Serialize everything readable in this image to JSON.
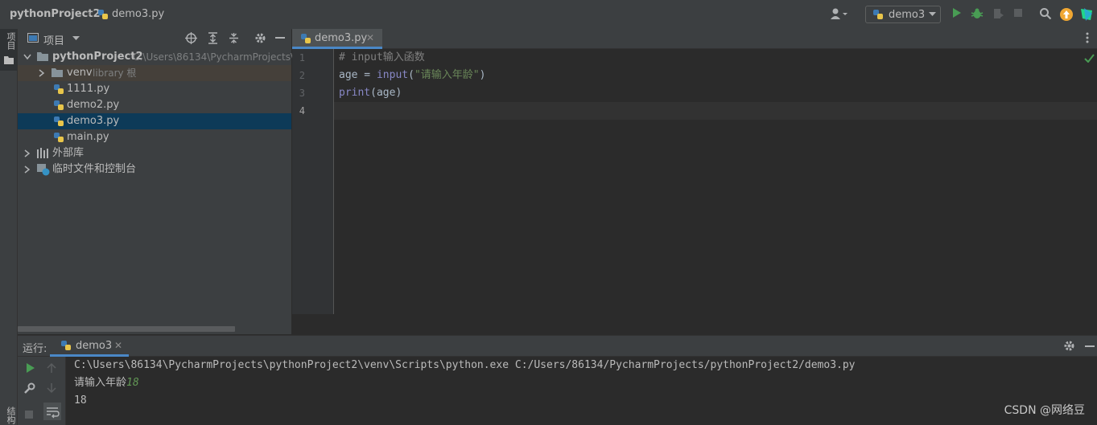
{
  "titlebar": {
    "project": "pythonProject2",
    "file": "demo3.py",
    "run_config": "demo3"
  },
  "left_strip": {
    "project_tab": "项目",
    "structure_tab": "结构"
  },
  "project_panel": {
    "title": "项目",
    "tree": [
      {
        "label": "pythonProject2",
        "hint": "C:\\Users\\86134\\PycharmProjects\\p",
        "type": "folder",
        "expanded": true
      },
      {
        "label": "venv",
        "hint": "library 根",
        "type": "folder",
        "expanded": false
      },
      {
        "label": "1111.py",
        "type": "python-file"
      },
      {
        "label": "demo2.py",
        "type": "python-file"
      },
      {
        "label": "demo3.py",
        "type": "python-file",
        "selected": true
      },
      {
        "label": "main.py",
        "type": "python-file"
      },
      {
        "label": "外部库",
        "type": "library"
      },
      {
        "label": "临时文件和控制台",
        "type": "scratch"
      }
    ]
  },
  "editor": {
    "tab": "demo3.py",
    "line_numbers": [
      "1",
      "2",
      "3",
      "4"
    ],
    "lines": [
      [
        {
          "t": "# input输入函数",
          "c": "comment"
        }
      ],
      [
        {
          "t": "age = ",
          "c": "plain"
        },
        {
          "t": "input",
          "c": "fn"
        },
        {
          "t": "(",
          "c": "plain"
        },
        {
          "t": "\"请输入年龄\"",
          "c": "str"
        },
        {
          "t": ")",
          "c": "plain"
        }
      ],
      [
        {
          "t": "print",
          "c": "fn"
        },
        {
          "t": "(age)",
          "c": "plain"
        }
      ],
      []
    ]
  },
  "run": {
    "label": "运行:",
    "tab": "demo3",
    "output": {
      "command": "C:\\Users\\86134\\PycharmProjects\\pythonProject2\\venv\\Scripts\\python.exe C:/Users/86134/PycharmProjects/pythonProject2/demo3.py",
      "prompt": "请输入年龄",
      "input": "18",
      "result": "18"
    }
  },
  "watermark": "CSDN @网络豆",
  "colors": {
    "accent": "#4a88c7",
    "run_green": "#499c54",
    "selection": "#0d3a58"
  }
}
